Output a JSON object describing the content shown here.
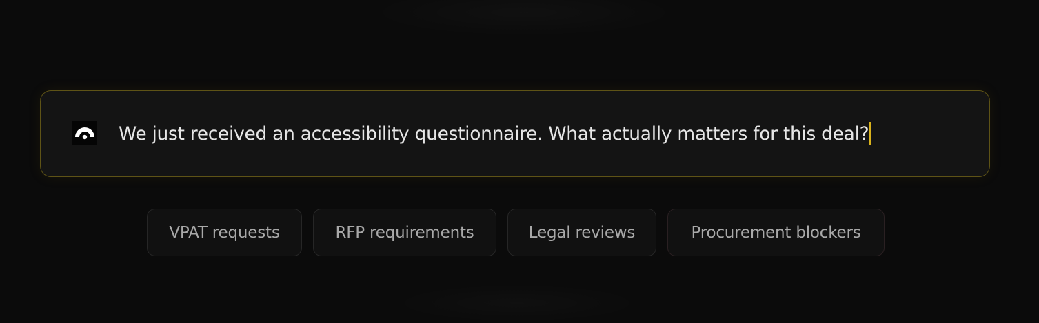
{
  "prompt": {
    "text": "We just received an accessibility questionnaire. What actually matters for this deal?",
    "logo_icon": "gauge-dome-icon"
  },
  "suggestions": [
    {
      "label": "VPAT requests"
    },
    {
      "label": "RFP requirements"
    },
    {
      "label": "Legal reviews"
    },
    {
      "label": "Procurement blockers"
    }
  ],
  "colors": {
    "background": "#0b0b0b",
    "input_background": "#141414",
    "input_border": "#5e5316",
    "cursor": "#d9b21c",
    "prompt_text": "#e6e6e6",
    "chip_text": "#a9a9a9"
  }
}
